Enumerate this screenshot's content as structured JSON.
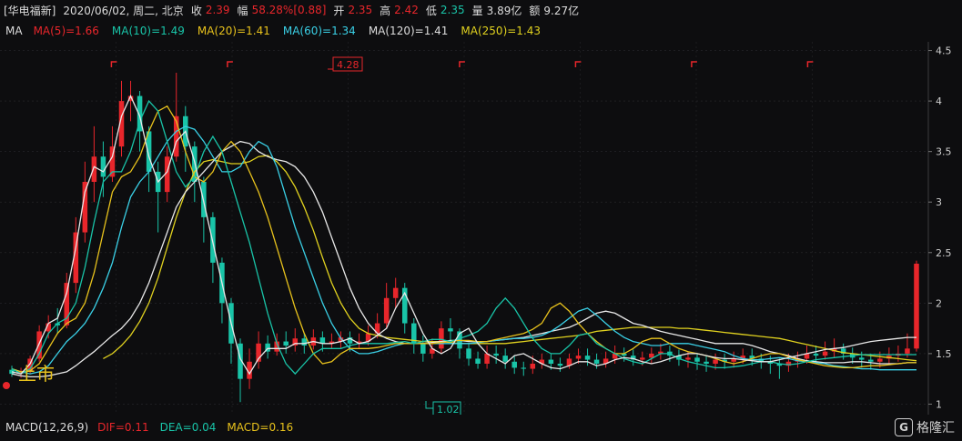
{
  "header": {
    "stock_name": "[华电福新]",
    "date": "2020/06/02, 周二, 北京",
    "close_label": "收",
    "close_value": "2.39",
    "change_label": "幅",
    "change_value": "58.28%",
    "change_abs": "[0.88]",
    "open_label": "开",
    "open_value": "2.35",
    "high_label": "高",
    "high_value": "2.42",
    "low_label": "低",
    "low_value": "2.35",
    "volume_label": "量",
    "volume_value": "3.89亿",
    "amount_label": "额",
    "amount_value": "9.27亿"
  },
  "ma_bar": {
    "label": "MA",
    "ma5": "MA(5)=1.66",
    "ma10": "MA(10)=1.49",
    "ma20": "MA(20)=1.41",
    "ma60": "MA(60)=1.34",
    "ma120": "MA(120)=1.41",
    "ma250": "MA(250)=1.43"
  },
  "macd_bar": {
    "label": "MACD(12,26,9)",
    "dif": "DIF=0.11",
    "dea": "DEA=0.04",
    "macd": "MACD=0.16"
  },
  "annotations": {
    "listing": "上市",
    "high_marker": "4.28",
    "low_marker": "1.02"
  },
  "logo": {
    "text": "格隆汇",
    "mark": "G"
  },
  "colors": {
    "up": "#e8262b",
    "down": "#19c4a8",
    "ma5": "#e8e8e8",
    "ma10": "#19c4a8",
    "ma20": "#e8c21c",
    "ma60": "#3ad0e6",
    "ma120": "#e8e8e8",
    "ma250": "#e1d21f",
    "label_text": "#dcdcdc",
    "background": "#0d0d0f",
    "grid": "#2a2a2e"
  },
  "chart_data": {
    "type": "candlestick",
    "y_ticks": [
      "4.5",
      "4",
      "3.5",
      "3",
      "2.5",
      "2",
      "1.5",
      "1"
    ],
    "ylim": [
      0.95,
      4.55
    ],
    "grid": true,
    "n_periods": 100,
    "series": [
      {
        "name": "MA(250)",
        "values": [
          null,
          null,
          null,
          null,
          null,
          null,
          null,
          null,
          null,
          null,
          1.45,
          1.5,
          1.58,
          1.68,
          1.82,
          2.0,
          2.25,
          2.55,
          2.85,
          3.1,
          3.3,
          3.4,
          3.42,
          3.4,
          3.38,
          3.38,
          3.4,
          3.45,
          3.46,
          3.4,
          3.3,
          3.15,
          2.95,
          2.72,
          2.45,
          2.2,
          2.0,
          1.85,
          1.75,
          1.7,
          1.68,
          1.66,
          1.65,
          1.64,
          1.63,
          1.62,
          1.62,
          1.62,
          1.61,
          1.6,
          1.6,
          1.6,
          1.6,
          1.6,
          1.6,
          1.61,
          1.62,
          1.63,
          1.64,
          1.65,
          1.66,
          1.67,
          1.68,
          1.7,
          1.72,
          1.73,
          1.74,
          1.75,
          1.76,
          1.76,
          1.76,
          1.76,
          1.76,
          1.75,
          1.75,
          1.74,
          1.73,
          1.72,
          1.71,
          1.7,
          1.69,
          1.68,
          1.67,
          1.66,
          1.65,
          1.63,
          1.61,
          1.59,
          1.57,
          1.55,
          1.53,
          1.51,
          1.5,
          1.49,
          1.48,
          1.47,
          1.46,
          1.45,
          1.44,
          1.43
        ]
      },
      {
        "name": "MA(120)",
        "values": [
          1.3,
          1.28,
          1.27,
          1.27,
          1.28,
          1.3,
          1.32,
          1.38,
          1.45,
          1.52,
          1.6,
          1.68,
          1.75,
          1.85,
          2.0,
          2.2,
          2.45,
          2.7,
          2.95,
          3.1,
          3.2,
          3.3,
          3.4,
          3.5,
          3.55,
          3.6,
          3.58,
          3.5,
          3.45,
          3.42,
          3.4,
          3.35,
          3.25,
          3.1,
          2.9,
          2.65,
          2.4,
          2.15,
          1.95,
          1.8,
          1.7,
          1.65,
          1.62,
          1.6,
          1.6,
          1.6,
          1.61,
          1.62,
          1.63,
          1.63,
          1.62,
          1.62,
          1.62,
          1.63,
          1.64,
          1.65,
          1.66,
          1.68,
          1.7,
          1.72,
          1.74,
          1.76,
          1.8,
          1.85,
          1.9,
          1.92,
          1.9,
          1.85,
          1.8,
          1.78,
          1.75,
          1.72,
          1.7,
          1.68,
          1.66,
          1.64,
          1.62,
          1.6,
          1.6,
          1.6,
          1.6,
          1.58,
          1.55,
          1.52,
          1.5,
          1.48,
          1.45,
          1.43,
          1.42,
          1.41,
          1.41,
          1.41,
          1.42,
          1.42,
          1.41,
          1.4,
          1.4,
          1.4,
          1.41,
          1.41
        ]
      },
      {
        "name": "MA(60)",
        "values": [
          1.35,
          1.32,
          1.3,
          1.32,
          1.38,
          1.5,
          1.62,
          1.7,
          1.8,
          1.95,
          2.15,
          2.4,
          2.75,
          3.05,
          3.2,
          3.3,
          3.45,
          3.6,
          3.7,
          3.75,
          3.72,
          3.6,
          3.45,
          3.3,
          3.3,
          3.35,
          3.5,
          3.6,
          3.55,
          3.35,
          3.05,
          2.75,
          2.5,
          2.25,
          2.0,
          1.8,
          1.65,
          1.55,
          1.5,
          1.5,
          1.52,
          1.55,
          1.58,
          1.6,
          1.6,
          1.6,
          1.6,
          1.6,
          1.6,
          1.6,
          1.6,
          1.61,
          1.62,
          1.63,
          1.64,
          1.65,
          1.65,
          1.66,
          1.68,
          1.72,
          1.78,
          1.85,
          1.92,
          1.95,
          1.88,
          1.8,
          1.72,
          1.66,
          1.62,
          1.6,
          1.58,
          1.58,
          1.6,
          1.6,
          1.6,
          1.58,
          1.56,
          1.54,
          1.52,
          1.48,
          1.45,
          1.44,
          1.44,
          1.45,
          1.46,
          1.45,
          1.43,
          1.42,
          1.41,
          1.4,
          1.38,
          1.37,
          1.36,
          1.35,
          1.35,
          1.34,
          1.34,
          1.34,
          1.34,
          1.34
        ]
      },
      {
        "name": "MA(20)",
        "values": [
          1.35,
          1.32,
          1.33,
          1.4,
          1.55,
          1.7,
          1.8,
          1.85,
          2.0,
          2.3,
          2.7,
          3.1,
          3.25,
          3.3,
          3.45,
          3.7,
          3.9,
          3.95,
          3.8,
          3.5,
          3.25,
          3.2,
          3.3,
          3.5,
          3.6,
          3.5,
          3.3,
          3.1,
          2.85,
          2.55,
          2.25,
          1.95,
          1.7,
          1.5,
          1.4,
          1.42,
          1.5,
          1.55,
          1.55,
          1.55,
          1.56,
          1.58,
          1.6,
          1.6,
          1.6,
          1.6,
          1.6,
          1.61,
          1.62,
          1.63,
          1.63,
          1.62,
          1.62,
          1.64,
          1.66,
          1.68,
          1.7,
          1.74,
          1.8,
          1.95,
          2.0,
          1.92,
          1.8,
          1.7,
          1.62,
          1.55,
          1.5,
          1.5,
          1.55,
          1.62,
          1.65,
          1.65,
          1.6,
          1.55,
          1.52,
          1.5,
          1.48,
          1.45,
          1.42,
          1.4,
          1.42,
          1.45,
          1.48,
          1.5,
          1.5,
          1.47,
          1.44,
          1.42,
          1.4,
          1.38,
          1.37,
          1.36,
          1.36,
          1.37,
          1.38,
          1.38,
          1.39,
          1.4,
          1.41,
          1.41
        ]
      },
      {
        "name": "MA(10)",
        "values": [
          1.35,
          1.3,
          1.35,
          1.5,
          1.7,
          1.8,
          1.85,
          2.0,
          2.35,
          2.8,
          3.2,
          3.3,
          3.3,
          3.5,
          3.8,
          4.0,
          3.9,
          3.6,
          3.3,
          3.15,
          3.25,
          3.5,
          3.65,
          3.5,
          3.2,
          2.9,
          2.6,
          2.25,
          1.9,
          1.6,
          1.4,
          1.3,
          1.4,
          1.5,
          1.55,
          1.55,
          1.55,
          1.58,
          1.6,
          1.6,
          1.6,
          1.6,
          1.61,
          1.62,
          1.6,
          1.62,
          1.64,
          1.64,
          1.62,
          1.65,
          1.68,
          1.72,
          1.8,
          1.95,
          2.05,
          1.95,
          1.8,
          1.65,
          1.55,
          1.5,
          1.5,
          1.58,
          1.68,
          1.7,
          1.6,
          1.55,
          1.5,
          1.45,
          1.42,
          1.4,
          1.45,
          1.5,
          1.5,
          1.45,
          1.42,
          1.4,
          1.38,
          1.36,
          1.36,
          1.37,
          1.38,
          1.4,
          1.42,
          1.42,
          1.4,
          1.39,
          1.4,
          1.42,
          1.44,
          1.45,
          1.46,
          1.47,
          1.48,
          1.49,
          1.49,
          1.49,
          1.49,
          1.49,
          1.49,
          1.49
        ]
      },
      {
        "name": "MA(5)",
        "values": [
          1.32,
          1.3,
          1.4,
          1.6,
          1.8,
          1.85,
          2.1,
          2.55,
          3.1,
          3.35,
          3.3,
          3.45,
          3.85,
          4.05,
          3.85,
          3.45,
          3.2,
          3.3,
          3.6,
          3.7,
          3.4,
          3.0,
          2.6,
          2.2,
          1.8,
          1.45,
          1.3,
          1.45,
          1.55,
          1.55,
          1.55,
          1.6,
          1.6,
          1.62,
          1.6,
          1.6,
          1.62,
          1.65,
          1.6,
          1.62,
          1.68,
          1.75,
          1.95,
          2.1,
          1.9,
          1.7,
          1.55,
          1.5,
          1.55,
          1.7,
          1.75,
          1.6,
          1.5,
          1.45,
          1.4,
          1.48,
          1.5,
          1.45,
          1.4,
          1.36,
          1.35,
          1.38,
          1.42,
          1.42,
          1.38,
          1.4,
          1.44,
          1.46,
          1.45,
          1.42,
          1.4,
          1.42,
          1.45,
          1.48,
          1.5,
          1.5,
          1.48,
          1.46,
          1.45,
          1.45,
          1.44,
          1.43,
          1.42,
          1.42,
          1.44,
          1.46,
          1.48,
          1.5,
          1.52,
          1.54,
          1.55,
          1.56,
          1.58,
          1.6,
          1.62,
          1.63,
          1.64,
          1.65,
          1.66,
          1.66
        ]
      }
    ],
    "candles": [
      [
        1.34,
        1.3,
        1.38,
        1.27
      ],
      [
        1.3,
        1.33,
        1.36,
        1.26
      ],
      [
        1.33,
        1.45,
        1.48,
        1.3
      ],
      [
        1.45,
        1.72,
        1.78,
        1.42
      ],
      [
        1.72,
        1.8,
        1.88,
        1.65
      ],
      [
        1.8,
        1.78,
        1.95,
        1.7
      ],
      [
        1.78,
        2.2,
        2.3,
        1.75
      ],
      [
        2.2,
        2.7,
        2.85,
        2.1
      ],
      [
        2.7,
        3.2,
        3.4,
        2.6
      ],
      [
        3.2,
        3.45,
        3.75,
        3.0
      ],
      [
        3.45,
        3.25,
        3.6,
        3.05
      ],
      [
        3.25,
        3.55,
        3.75,
        3.2
      ],
      [
        3.55,
        4.0,
        4.2,
        3.45
      ],
      [
        4.0,
        4.05,
        4.2,
        3.8
      ],
      [
        4.05,
        3.7,
        4.1,
        3.5
      ],
      [
        3.7,
        3.3,
        3.75,
        3.1
      ],
      [
        3.3,
        3.1,
        3.4,
        2.7
      ],
      [
        3.1,
        3.45,
        3.55,
        3.0
      ],
      [
        3.45,
        3.85,
        4.28,
        3.4
      ],
      [
        3.85,
        3.55,
        3.95,
        3.3
      ],
      [
        3.55,
        3.2,
        3.6,
        3.0
      ],
      [
        3.2,
        2.85,
        3.25,
        2.6
      ],
      [
        2.85,
        2.4,
        2.9,
        2.2
      ],
      [
        2.4,
        2.0,
        2.45,
        1.8
      ],
      [
        2.0,
        1.6,
        2.05,
        1.4
      ],
      [
        1.6,
        1.25,
        1.65,
        1.02
      ],
      [
        1.25,
        1.42,
        1.55,
        1.15
      ],
      [
        1.42,
        1.6,
        1.72,
        1.35
      ],
      [
        1.6,
        1.52,
        1.68,
        1.45
      ],
      [
        1.52,
        1.62,
        1.7,
        1.48
      ],
      [
        1.62,
        1.58,
        1.72,
        1.5
      ],
      [
        1.58,
        1.65,
        1.75,
        1.52
      ],
      [
        1.65,
        1.58,
        1.7,
        1.5
      ],
      [
        1.58,
        1.66,
        1.74,
        1.54
      ],
      [
        1.66,
        1.6,
        1.72,
        1.52
      ],
      [
        1.6,
        1.62,
        1.7,
        1.55
      ],
      [
        1.62,
        1.66,
        1.72,
        1.55
      ],
      [
        1.66,
        1.6,
        1.72,
        1.52
      ],
      [
        1.6,
        1.62,
        1.7,
        1.55
      ],
      [
        1.62,
        1.7,
        1.78,
        1.58
      ],
      [
        1.7,
        1.8,
        1.9,
        1.65
      ],
      [
        1.8,
        2.05,
        2.2,
        1.75
      ],
      [
        2.05,
        2.15,
        2.25,
        1.95
      ],
      [
        2.15,
        1.8,
        2.2,
        1.7
      ],
      [
        1.8,
        1.6,
        1.85,
        1.5
      ],
      [
        1.6,
        1.5,
        1.68,
        1.42
      ],
      [
        1.5,
        1.55,
        1.65,
        1.45
      ],
      [
        1.55,
        1.75,
        1.82,
        1.5
      ],
      [
        1.75,
        1.72,
        1.85,
        1.6
      ],
      [
        1.72,
        1.55,
        1.75,
        1.45
      ],
      [
        1.55,
        1.45,
        1.6,
        1.38
      ],
      [
        1.45,
        1.4,
        1.52,
        1.35
      ],
      [
        1.4,
        1.5,
        1.58,
        1.35
      ],
      [
        1.5,
        1.48,
        1.58,
        1.4
      ],
      [
        1.48,
        1.42,
        1.55,
        1.35
      ],
      [
        1.42,
        1.36,
        1.48,
        1.3
      ],
      [
        1.36,
        1.35,
        1.42,
        1.28
      ],
      [
        1.35,
        1.4,
        1.48,
        1.3
      ],
      [
        1.4,
        1.44,
        1.5,
        1.35
      ],
      [
        1.44,
        1.4,
        1.5,
        1.34
      ],
      [
        1.4,
        1.38,
        1.46,
        1.32
      ],
      [
        1.38,
        1.45,
        1.5,
        1.35
      ],
      [
        1.45,
        1.48,
        1.55,
        1.4
      ],
      [
        1.48,
        1.44,
        1.55,
        1.38
      ],
      [
        1.44,
        1.4,
        1.5,
        1.35
      ],
      [
        1.4,
        1.45,
        1.52,
        1.36
      ],
      [
        1.45,
        1.5,
        1.58,
        1.4
      ],
      [
        1.5,
        1.48,
        1.56,
        1.42
      ],
      [
        1.48,
        1.44,
        1.54,
        1.38
      ],
      [
        1.44,
        1.46,
        1.52,
        1.38
      ],
      [
        1.46,
        1.5,
        1.56,
        1.4
      ],
      [
        1.5,
        1.52,
        1.6,
        1.44
      ],
      [
        1.52,
        1.48,
        1.58,
        1.42
      ],
      [
        1.48,
        1.44,
        1.54,
        1.38
      ],
      [
        1.44,
        1.46,
        1.52,
        1.36
      ],
      [
        1.46,
        1.42,
        1.5,
        1.34
      ],
      [
        1.42,
        1.4,
        1.48,
        1.32
      ],
      [
        1.4,
        1.44,
        1.5,
        1.34
      ],
      [
        1.44,
        1.42,
        1.5,
        1.35
      ],
      [
        1.42,
        1.45,
        1.52,
        1.36
      ],
      [
        1.45,
        1.48,
        1.55,
        1.4
      ],
      [
        1.48,
        1.45,
        1.55,
        1.38
      ],
      [
        1.45,
        1.42,
        1.5,
        1.35
      ],
      [
        1.42,
        1.4,
        1.48,
        1.3
      ],
      [
        1.4,
        1.38,
        1.45,
        1.25
      ],
      [
        1.38,
        1.42,
        1.5,
        1.32
      ],
      [
        1.42,
        1.45,
        1.52,
        1.36
      ],
      [
        1.45,
        1.5,
        1.58,
        1.4
      ],
      [
        1.5,
        1.48,
        1.58,
        1.42
      ],
      [
        1.48,
        1.52,
        1.62,
        1.44
      ],
      [
        1.52,
        1.55,
        1.65,
        1.46
      ],
      [
        1.55,
        1.5,
        1.6,
        1.44
      ],
      [
        1.5,
        1.46,
        1.56,
        1.4
      ],
      [
        1.46,
        1.44,
        1.52,
        1.36
      ],
      [
        1.44,
        1.42,
        1.5,
        1.34
      ],
      [
        1.42,
        1.45,
        1.52,
        1.36
      ],
      [
        1.45,
        1.48,
        1.56,
        1.4
      ],
      [
        1.48,
        1.5,
        1.58,
        1.42
      ],
      [
        1.5,
        1.55,
        1.7,
        1.46
      ],
      [
        1.55,
        2.39,
        2.42,
        1.52
      ]
    ]
  }
}
